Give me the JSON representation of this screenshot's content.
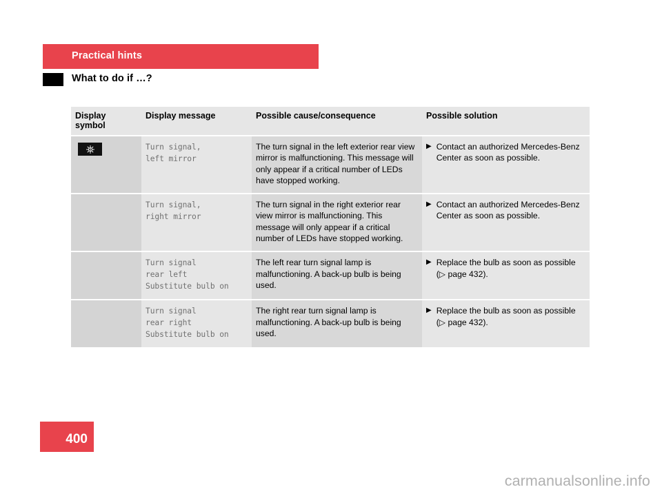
{
  "header": {
    "chapter_title": "Practical hints",
    "section_title": "What to do if …?",
    "band_color": "#e8434c"
  },
  "table": {
    "columns": [
      "Display symbol",
      "Display message",
      "Possible cause/consequence",
      "Possible solution"
    ],
    "rows": [
      {
        "symbol": "bulb-failure-icon",
        "has_symbol": true,
        "message": "Turn signal,\nleft mirror",
        "cause": "The turn signal in the left exterior rear view mirror is malfunctioning. This message will only appear if a critical number of LEDs have stopped working.",
        "solution": "Contact an authorized Mercedes-Benz Center as soon as possible.",
        "solution_bullet": "▶"
      },
      {
        "symbol": "",
        "has_symbol": false,
        "message": "Turn signal,\nright mirror",
        "cause": "The turn signal in the right exterior rear view mirror is malfunctioning. This message will only appear if a critical number of LEDs have stopped working.",
        "solution": "Contact an authorized Mercedes-Benz Center as soon as possible.",
        "solution_bullet": "▶"
      },
      {
        "symbol": "",
        "has_symbol": false,
        "message": "Turn signal\nrear left\nSubstitute bulb on",
        "cause": "The left rear turn signal lamp is malfunctioning. A back-up bulb is being used.",
        "solution": "Replace the bulb as soon as possible (▷ page 432).",
        "solution_bullet": "▶"
      },
      {
        "symbol": "",
        "has_symbol": false,
        "message": "Turn signal\nrear right\nSubstitute bulb on",
        "cause": "The right rear turn signal lamp is malfunctioning. A back-up bulb is being used.",
        "solution": "Replace the bulb as soon as possible (▷ page 432).",
        "solution_bullet": "▶"
      }
    ]
  },
  "footer": {
    "page_number": "400",
    "watermark": "carmanualsonline.info"
  }
}
